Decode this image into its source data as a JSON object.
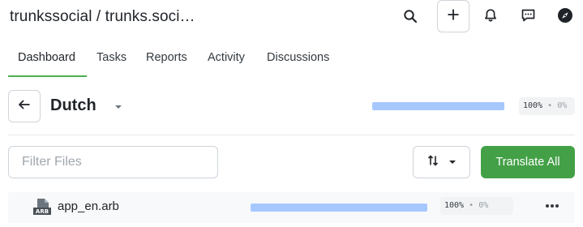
{
  "header": {
    "title": "trunkssocial / trunks.soci…",
    "icons": [
      "search-icon",
      "plus-icon",
      "bell-icon",
      "message-icon",
      "compass-icon"
    ]
  },
  "tabs": [
    {
      "label": "Dashboard",
      "active": true
    },
    {
      "label": "Tasks",
      "active": false
    },
    {
      "label": "Reports",
      "active": false
    },
    {
      "label": "Activity",
      "active": false
    },
    {
      "label": "Discussions",
      "active": false
    }
  ],
  "language": {
    "name": "Dutch",
    "progress": 100,
    "progress_label": "100%",
    "separator": "•",
    "secondary_label": "0%"
  },
  "filter": {
    "placeholder": "Filter Files",
    "value": ""
  },
  "toolbar": {
    "translate_label": "Translate All"
  },
  "files": [
    {
      "name": "app_en.arb",
      "badge": "ARB",
      "progress": 100,
      "progress_label": "100%",
      "separator": "•",
      "secondary_label": "0%"
    }
  ],
  "colors": {
    "accent": "#43a047",
    "progress": "#a6c8ff",
    "tab_underline": "#4caf50"
  }
}
